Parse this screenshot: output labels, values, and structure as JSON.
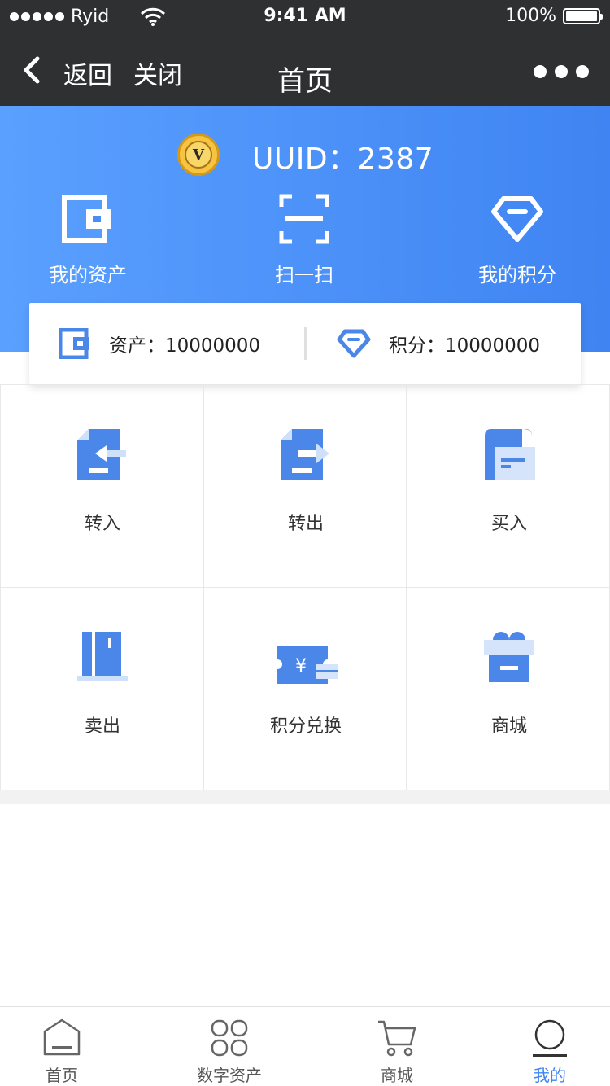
{
  "status_bar": {
    "carrier": "Ryid",
    "time": "9:41 AM",
    "battery": "100%"
  },
  "nav": {
    "back_label": "返回",
    "close_label": "关闭",
    "title": "首页"
  },
  "header": {
    "uuid_text": "UUID：2387",
    "quick_actions": [
      {
        "label": "我的资产",
        "icon": "wallet-icon"
      },
      {
        "label": "扫一扫",
        "icon": "scan-icon"
      },
      {
        "label": "我的积分",
        "icon": "diamond-icon"
      }
    ]
  },
  "summary": {
    "asset_text": "资产：10000000",
    "points_text": "积分：10000000"
  },
  "grid": [
    {
      "label": "转入",
      "icon": "transfer-in-icon"
    },
    {
      "label": "转出",
      "icon": "transfer-out-icon"
    },
    {
      "label": "买入",
      "icon": "buy-icon"
    },
    {
      "label": "卖出",
      "icon": "sell-icon"
    },
    {
      "label": "积分兑换",
      "icon": "points-exchange-icon"
    },
    {
      "label": "商城",
      "icon": "mall-gift-icon"
    }
  ],
  "tabbar": [
    {
      "label": "首页",
      "icon": "home-icon",
      "active": false
    },
    {
      "label": "数字资产",
      "icon": "digital-assets-icon",
      "active": false
    },
    {
      "label": "商城",
      "icon": "cart-icon",
      "active": false
    },
    {
      "label": "我的",
      "icon": "profile-icon",
      "active": true
    }
  ],
  "colors": {
    "header_start": "#5aa0ff",
    "header_end": "#3f84f2",
    "icon_blue": "#4a87e8",
    "active_tab": "#3f84f2",
    "bar_dark": "#2f3032"
  }
}
